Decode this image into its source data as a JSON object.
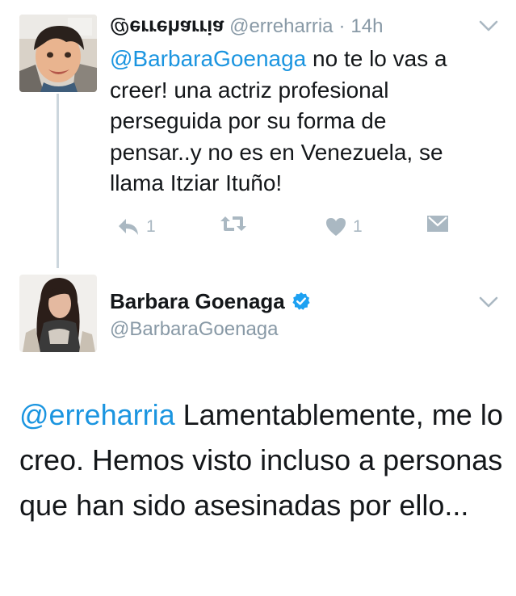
{
  "tweet1": {
    "display_name": "@erreharria",
    "screen_name": "@erreharria",
    "separator": "·",
    "time": "14h",
    "mention": "@BarbaraGoenaga",
    "text": " no te lo vas a creer! una actriz profesional perseguida por su forma de pensar..y no es en Venezuela, se llama Itziar Ituño!",
    "reply_count": "1",
    "like_count": "1",
    "avatar_icon": "child-photo-avatar"
  },
  "tweet2": {
    "display_name": "Barbara Goenaga",
    "screen_name": "@BarbaraGoenaga",
    "verified_icon": "verified-badge-icon",
    "mention": "@erreharria",
    "text": " Lamentablemente, me lo creo. Hemos visto incluso a personas que han sido asesinadas por ello...",
    "avatar_icon": "woman-photo-avatar"
  },
  "colors": {
    "link": "#1b95e0",
    "muted": "#8899a6",
    "action": "#aab8c2",
    "verified": "#1da1f2",
    "thread_line": "#ccd6dd"
  }
}
